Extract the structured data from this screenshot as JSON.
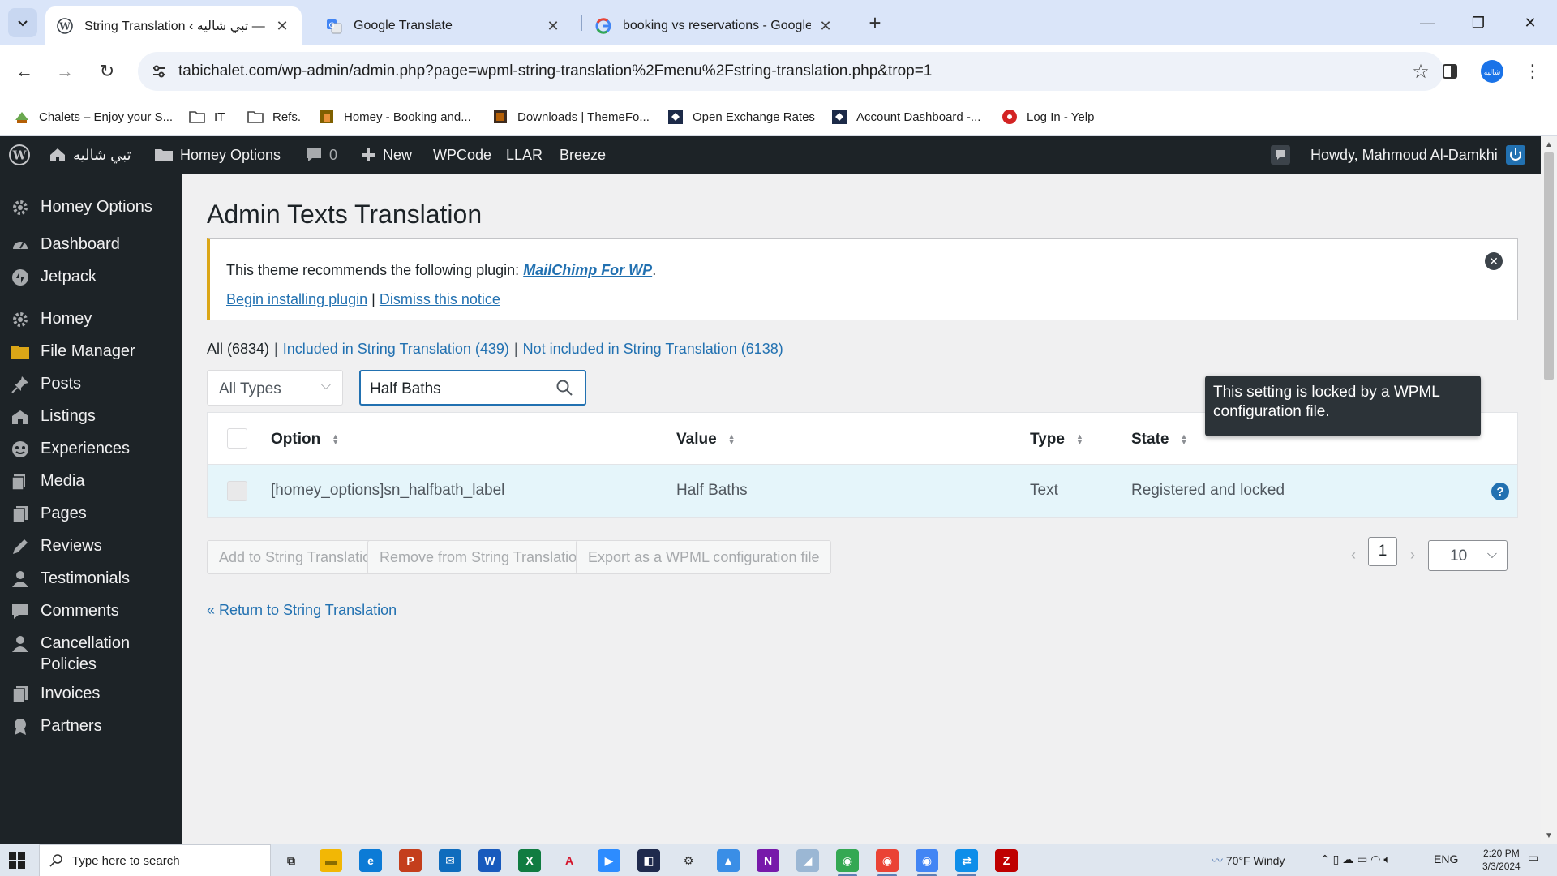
{
  "browser": {
    "tabs": [
      {
        "title": "String Translation ‹ تبي شاليه — W",
        "active": true
      },
      {
        "title": "Google Translate",
        "active": false
      },
      {
        "title": "booking vs reservations - Google S",
        "active": false
      }
    ],
    "url": "tabichalet.com/wp-admin/admin.php?page=wpml-string-translation%2Fmenu%2Fstring-translation.php&trop=1",
    "bookmarks": [
      {
        "label": "Chalets – Enjoy your S...",
        "icon": "site-icon"
      },
      {
        "label": "IT",
        "icon": "folder-icon"
      },
      {
        "label": "Refs.",
        "icon": "folder-icon"
      },
      {
        "label": "Homey - Booking and...",
        "icon": "site-icon"
      },
      {
        "label": "Downloads | ThemeFo...",
        "icon": "site-icon"
      },
      {
        "label": "Open Exchange Rates",
        "icon": "site-icon"
      },
      {
        "label": "Account Dashboard -...",
        "icon": "site-icon"
      },
      {
        "label": "Log In - Yelp",
        "icon": "yelp-icon"
      }
    ]
  },
  "adminbar": {
    "site_name": "تبي شاليه",
    "homey_options": "Homey Options",
    "comments_count": "0",
    "new": "New",
    "wpcode": "WPCode",
    "llar": "LLAR",
    "breeze": "Breeze",
    "howdy": "Howdy, Mahmoud Al-Damkhi"
  },
  "sidebar": {
    "items": [
      {
        "label": "Homey Options",
        "icon": "gear-icon"
      },
      {
        "label": "Dashboard",
        "icon": "dashboard-icon"
      },
      {
        "label": "Jetpack",
        "icon": "jetpack-icon"
      },
      {
        "label": "Homey",
        "icon": "gear-icon"
      },
      {
        "label": "File Manager",
        "icon": "folder-icon"
      },
      {
        "label": "Posts",
        "icon": "pin-icon"
      },
      {
        "label": "Listings",
        "icon": "building-icon"
      },
      {
        "label": "Experiences",
        "icon": "experiences-icon"
      },
      {
        "label": "Media",
        "icon": "media-icon"
      },
      {
        "label": "Pages",
        "icon": "pages-icon"
      },
      {
        "label": "Reviews",
        "icon": "pencil-icon"
      },
      {
        "label": "Testimonials",
        "icon": "user-icon"
      },
      {
        "label": "Comments",
        "icon": "comment-icon"
      },
      {
        "label": "Cancellation Policies",
        "icon": "user-icon"
      },
      {
        "label": "Invoices",
        "icon": "pages-icon"
      },
      {
        "label": "Partners",
        "icon": "award-icon"
      }
    ]
  },
  "page": {
    "title": "Admin Texts Translation",
    "notice": {
      "text": "This theme recommends the following plugin: ",
      "plugin": "MailChimp For WP",
      "period": ".",
      "begin_link": "Begin installing plugin",
      "separator": "|",
      "dismiss_link": "Dismiss this notice"
    },
    "filters": {
      "all": "All (6834)",
      "included": "Included in String Translation (439)",
      "not_included": "Not included in String Translation (6138)",
      "sep": "|"
    },
    "type_select": "All Types",
    "search_value": "Half Baths",
    "table": {
      "headers": {
        "option": "Option",
        "value": "Value",
        "type": "Type",
        "state": "State"
      },
      "rows": [
        {
          "option": "[homey_options]sn_halfbath_label",
          "value": "Half Baths",
          "type": "Text",
          "state": "Registered and locked"
        }
      ]
    },
    "tooltip": "This setting is locked by a WPML configuration file.",
    "buttons": {
      "add": "Add to String Translation",
      "remove": "Remove from String Translation",
      "export": "Export as a WPML configuration file"
    },
    "pagination": {
      "current": "1",
      "per_page": "10"
    },
    "return_link": "« Return to String Translation"
  },
  "taskbar": {
    "search_placeholder": "Type here to search",
    "weather": "70°F  Windy",
    "lang": "ENG",
    "time": "2:20 PM",
    "date": "3/3/2024"
  }
}
